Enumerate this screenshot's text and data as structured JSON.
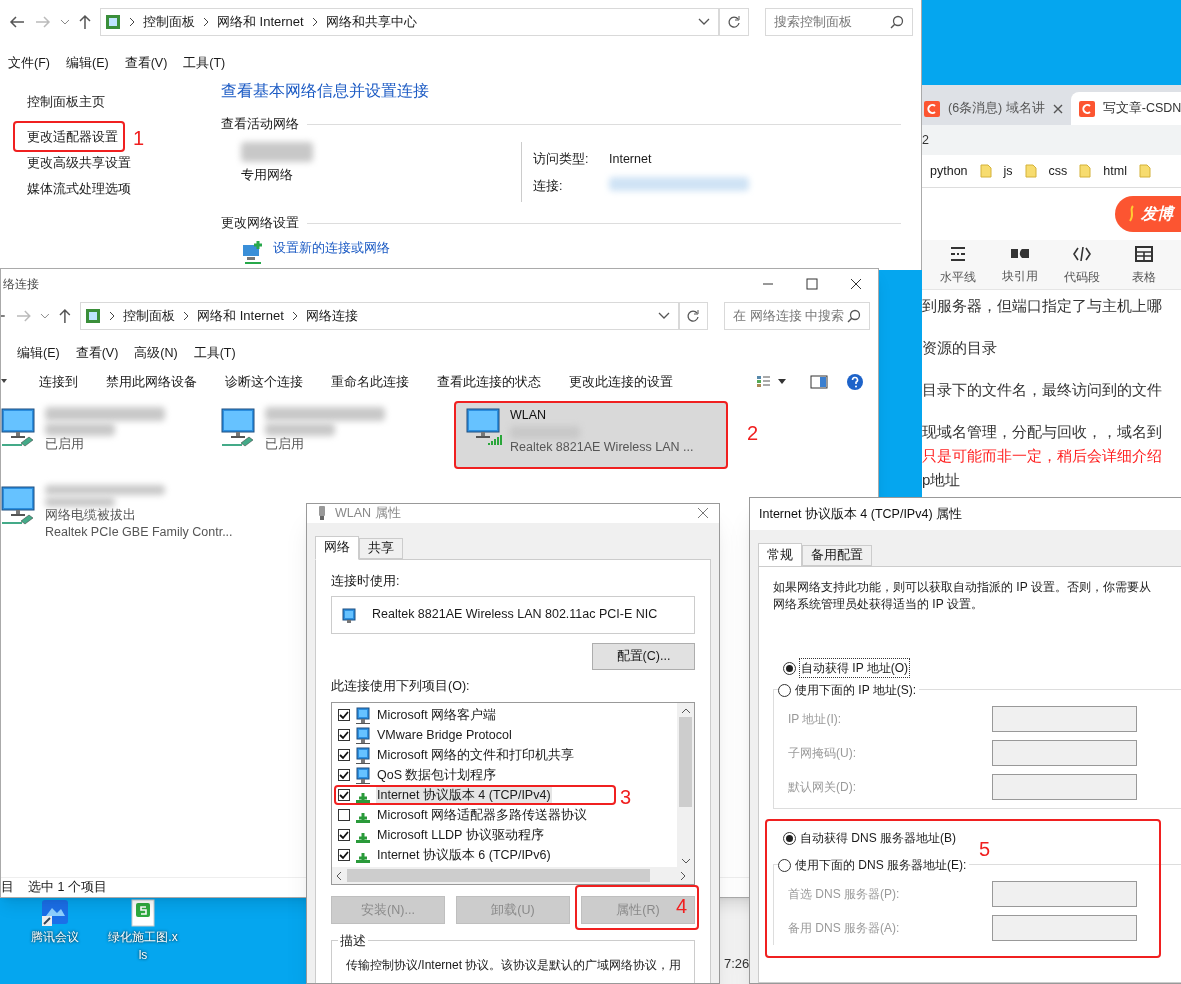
{
  "sharing_center": {
    "breadcrumbs": [
      "控制面板",
      "网络和 Internet",
      "网络和共享中心"
    ],
    "search_placeholder": "搜索控制面板",
    "menu": [
      "文件(F)",
      "编辑(E)",
      "查看(V)",
      "工具(T)"
    ],
    "sidebar": [
      {
        "label": "控制面板主页"
      },
      {
        "label": "更改适配器设置",
        "annotation": "1"
      },
      {
        "label": "更改高级共享设置"
      },
      {
        "label": "媒体流式处理选项"
      }
    ],
    "heading": "查看基本网络信息并设置连接",
    "active_networks_title": "查看活动网络",
    "network_category": "专用网络",
    "access_type_label": "访问类型:",
    "access_type_value": "Internet",
    "connections_label": "连接:",
    "change_settings_title": "更改网络设置",
    "new_connection_link": "设置新的连接或网络"
  },
  "connections_window": {
    "title": "络连接",
    "breadcrumbs": [
      "控制面板",
      "网络和 Internet",
      "网络连接"
    ],
    "search_placeholder": "在 网络连接 中搜索",
    "menu": [
      "编辑(E)",
      "查看(V)",
      "高级(N)",
      "工具(T)"
    ],
    "toolbar": [
      "连接到",
      "禁用此网络设备",
      "诊断这个连接",
      "重命名此连接",
      "查看此连接的状态",
      "更改此连接的设置"
    ],
    "adapters": [
      {
        "kind": "wired",
        "status": "已启用",
        "selected": false
      },
      {
        "kind": "wired",
        "status": "已启用",
        "selected": false
      },
      {
        "kind": "wireless",
        "name": "WLAN",
        "device": "Realtek 8821AE Wireless LAN ...",
        "selected": true,
        "annotation": "2"
      },
      {
        "kind": "unplugged",
        "status": "网络电缆被拔出",
        "device": "Realtek PCIe GBE Family Contr...",
        "selected": false
      }
    ],
    "status_bar": [
      "目",
      "选中 1 个项目"
    ]
  },
  "wlan_properties": {
    "title": "WLAN 属性",
    "tabs": [
      {
        "label": "网络",
        "selected": true
      },
      {
        "label": "共享",
        "selected": false
      }
    ],
    "connect_using_label": "连接时使用:",
    "adapter": "Realtek 8821AE Wireless LAN 802.11ac PCI-E NIC",
    "configure_button": "配置(C)...",
    "items_label": "此连接使用下列项目(O):",
    "items": [
      {
        "kind": "client",
        "label": "Microsoft 网络客户端",
        "checked": true,
        "selected": false
      },
      {
        "kind": "client",
        "label": "VMware Bridge Protocol",
        "checked": true,
        "selected": false
      },
      {
        "kind": "client",
        "label": "Microsoft 网络的文件和打印机共享",
        "checked": true,
        "selected": false
      },
      {
        "kind": "client",
        "label": "QoS 数据包计划程序",
        "checked": true,
        "selected": false
      },
      {
        "kind": "protocol",
        "label": "Internet 协议版本 4 (TCP/IPv4)",
        "checked": true,
        "selected": true,
        "annotation": "3"
      },
      {
        "kind": "protocol",
        "label": "Microsoft 网络适配器多路传送器协议",
        "checked": false,
        "selected": false
      },
      {
        "kind": "protocol",
        "label": "Microsoft LLDP 协议驱动程序",
        "checked": true,
        "selected": false
      },
      {
        "kind": "protocol",
        "label": "Internet 协议版本 6 (TCP/IPv6)",
        "checked": true,
        "selected": false
      }
    ],
    "buttons": [
      {
        "label": "安装(N)...",
        "disabled": true
      },
      {
        "label": "卸载(U)",
        "disabled": true
      },
      {
        "label": "属性(R)",
        "disabled": true,
        "annotation": "4"
      }
    ],
    "description_title": "描述",
    "description": "传输控制协议/Internet 协议。该协议是默认的广域网络协议，用"
  },
  "ipv4_properties": {
    "title": "Internet 协议版本 4 (TCP/IPv4) 属性",
    "tabs": [
      {
        "label": "常规",
        "selected": true
      },
      {
        "label": "备用配置",
        "selected": false
      }
    ],
    "intro": "如果网络支持此功能，则可以获取自动指派的 IP 设置。否则，你需要从网络系统管理员处获得适当的 IP 设置。",
    "ip_options": [
      {
        "label": "自动获得 IP 地址(O)",
        "selected": true
      },
      {
        "label": "使用下面的 IP 地址(S):",
        "selected": false
      }
    ],
    "ip_fields": [
      "IP 地址(I):",
      "子网掩码(U):",
      "默认网关(D):"
    ],
    "dns_options": [
      {
        "label": "自动获得 DNS 服务器地址(B)",
        "selected": true
      },
      {
        "label": "使用下面的 DNS 服务器地址(E):",
        "selected": false
      }
    ],
    "dns_fields": [
      "首选 DNS 服务器(P):",
      "备用 DNS 服务器(A):"
    ],
    "dns_annotation": "5"
  },
  "browser": {
    "tabs": [
      {
        "title": "(6条消息) 域名讲",
        "selected": false
      },
      {
        "title": "写文章-CSDN",
        "selected": true
      }
    ],
    "address": "2",
    "bookmarks": [
      "python",
      "js",
      "css",
      "html"
    ],
    "publish_button": "发博",
    "editor_tools": [
      {
        "kind": "rule",
        "label": "水平线"
      },
      {
        "kind": "quote",
        "label": "块引用"
      },
      {
        "kind": "code",
        "label": "代码段"
      },
      {
        "kind": "table",
        "label": "表格"
      }
    ],
    "lines": [
      {
        "kind": "normal",
        "text": "到服务器，但端口指定了与主机上哪"
      },
      {
        "kind": "gap"
      },
      {
        "kind": "normal",
        "text": "资源的目录"
      },
      {
        "kind": "gap"
      },
      {
        "kind": "normal",
        "text": "目录下的文件名，最终访问到的文件"
      },
      {
        "kind": "gap"
      },
      {
        "kind": "normal",
        "text": "现域名管理，分配与回收，，域名到"
      },
      {
        "kind": "highlight",
        "text": "只是可能而非一定，稍后会详细介绍"
      },
      {
        "kind": "normal",
        "text": "p地址"
      }
    ]
  },
  "desktop": {
    "icons": [
      {
        "kind": "meeting",
        "label": "腾讯会议"
      },
      {
        "kind": "sheet",
        "label": "绿化施工图.xls"
      }
    ],
    "clock": "7:26"
  }
}
